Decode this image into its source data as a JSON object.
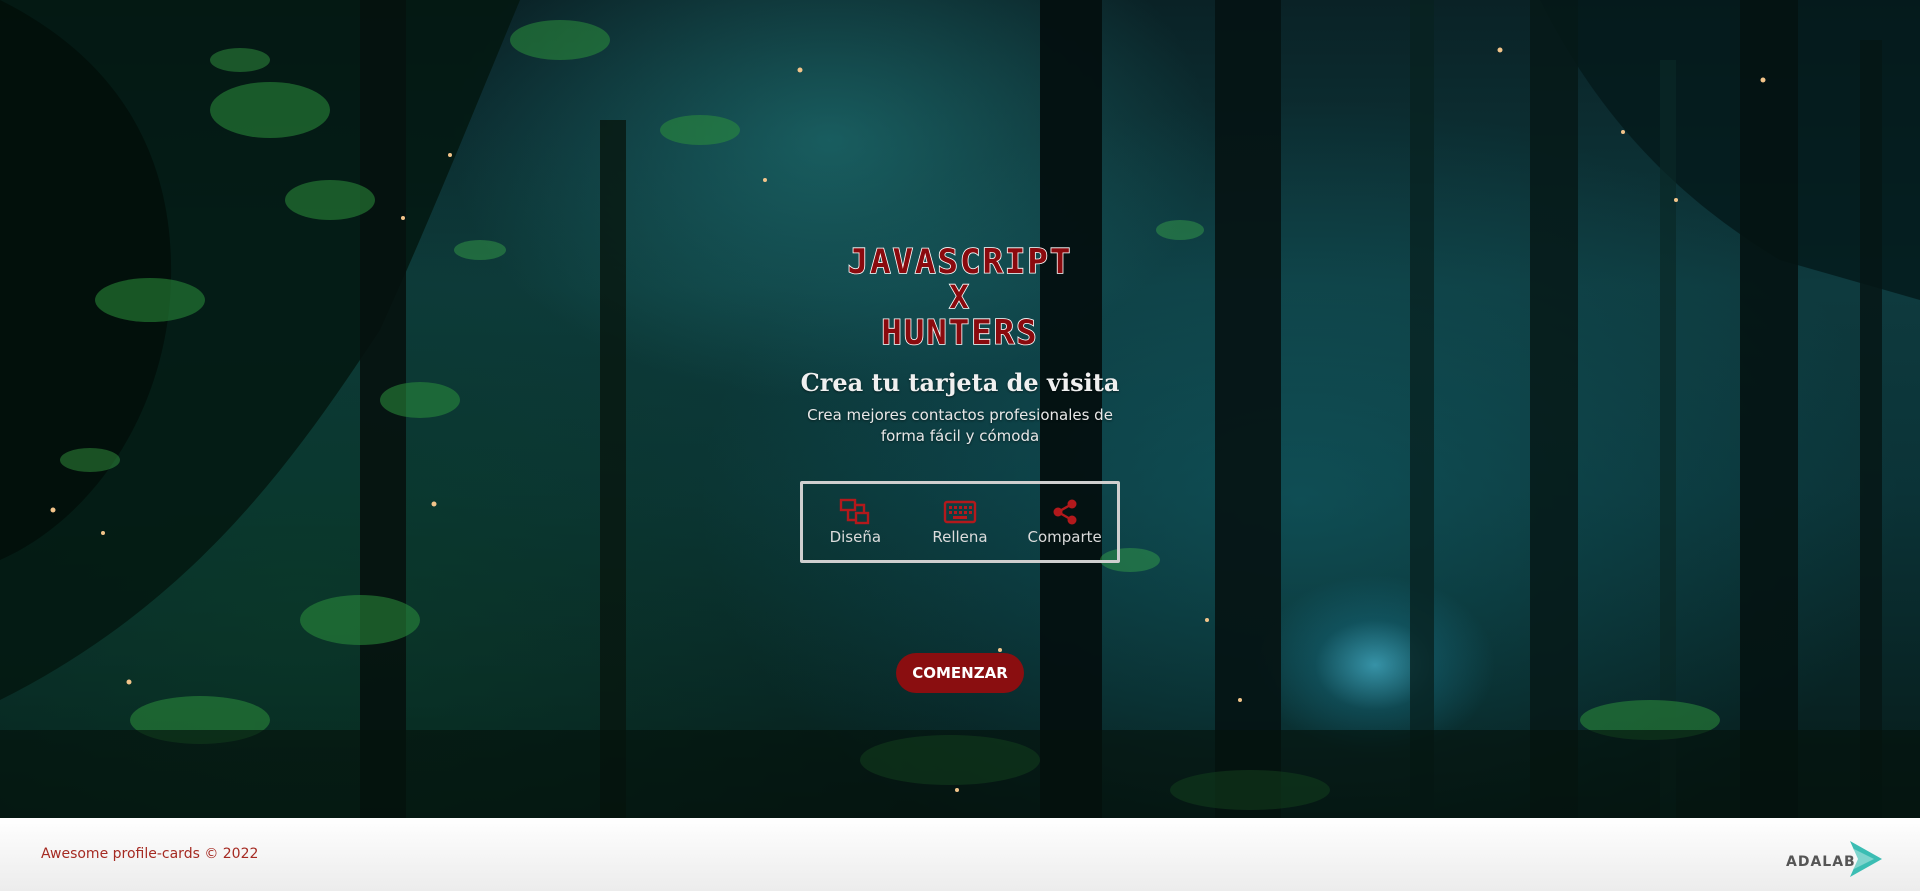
{
  "hero": {
    "logo_lines": [
      "JAVASCRIPT",
      "X",
      "HUNTERS"
    ],
    "title": "Crea tu tarjeta de visita",
    "subtitle": "Crea mejores contactos profesionales de forma fácil y cómoda",
    "steps": [
      {
        "label": "Diseña",
        "icon": "design-icon"
      },
      {
        "label": "Rellena",
        "icon": "keyboard-icon"
      },
      {
        "label": "Comparte",
        "icon": "share-icon"
      }
    ],
    "start_label": "COMENZAR"
  },
  "footer": {
    "copyright": "Awesome profile-cards © 2022",
    "brand": "ADALAB"
  },
  "colors": {
    "accent": "#8a0e10",
    "footer_text": "#a52a22",
    "brand_teal": "#3bbdb3"
  }
}
